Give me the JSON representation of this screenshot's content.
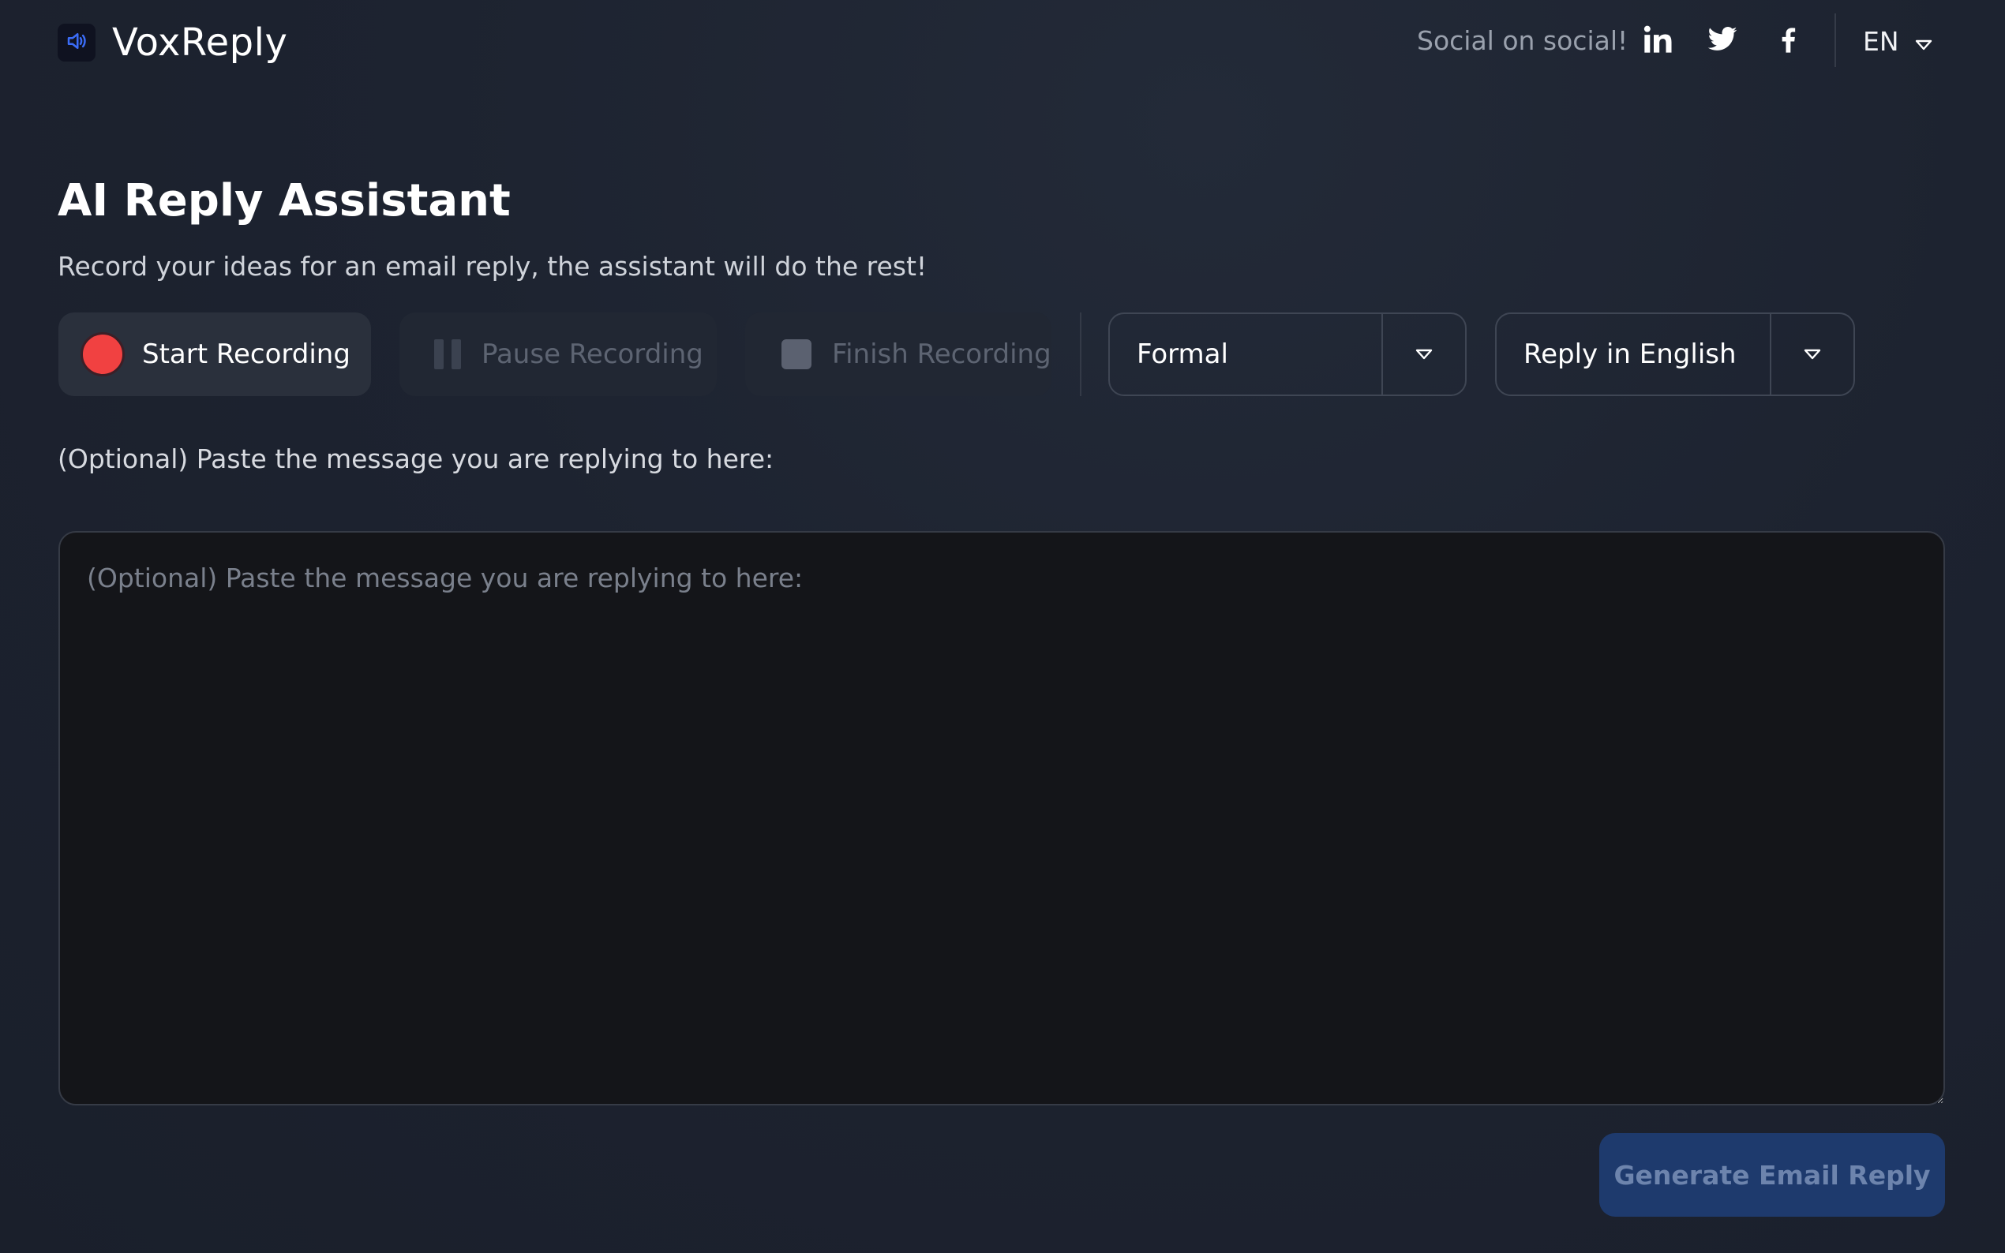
{
  "header": {
    "brand": "VoxReply",
    "logo_icon": "speaker-icon",
    "social_text": "Social on social!",
    "social_icons": [
      "linkedin-icon",
      "twitter-icon",
      "facebook-icon"
    ],
    "language": "EN"
  },
  "main": {
    "title": "AI Reply Assistant",
    "subtitle": "Record your ideas for an email reply, the assistant will do the rest!",
    "recording": {
      "start_label": "Start Recording",
      "pause_label": "Pause Recording",
      "finish_label": "Finish Recording"
    },
    "tone_select": {
      "selected": "Formal"
    },
    "language_select": {
      "selected": "Reply in English"
    },
    "message_label": "(Optional) Paste the message you are replying to here:",
    "message_input": {
      "value": "",
      "placeholder": "(Optional) Paste the message you are replying to here:"
    },
    "generate_label": "Generate Email Reply"
  },
  "colors": {
    "background": "#1d2330",
    "record_red": "#f14141",
    "primary_button": "#1e3a6d",
    "logo_accent": "#3b6cf6"
  }
}
